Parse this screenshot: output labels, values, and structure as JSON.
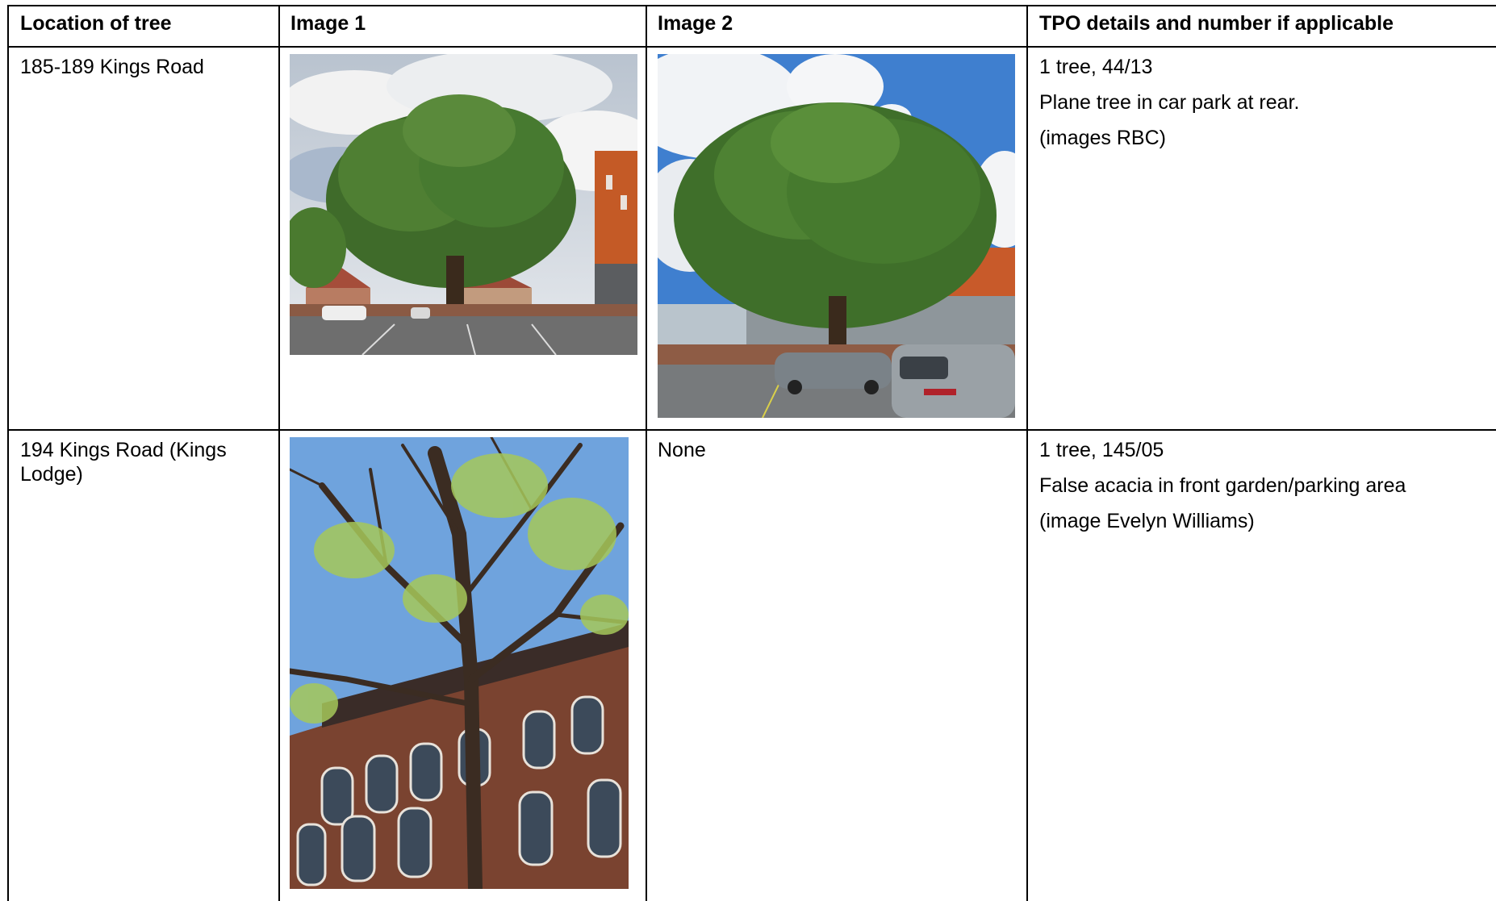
{
  "table": {
    "headers": {
      "location": "Location of tree",
      "image1": "Image 1",
      "image2": "Image 2",
      "tpo": "TPO details and number if applicable"
    },
    "rows": [
      {
        "location": "185-189 Kings Road",
        "image1": "photo-plane-tree-car-park",
        "image2": "photo-plane-tree-car-park-with-cars",
        "tpo": [
          "1 tree, 44/13",
          "Plane tree in car park at rear.",
          "(images RBC)"
        ]
      },
      {
        "location": "194 Kings Road (Kings Lodge)",
        "image1": "photo-false-acacia-brick-building",
        "image2_text": "None",
        "tpo": [
          "1 tree, 145/05",
          "False acacia in front garden/parking area",
          "(image Evelyn Williams)"
        ]
      }
    ]
  }
}
